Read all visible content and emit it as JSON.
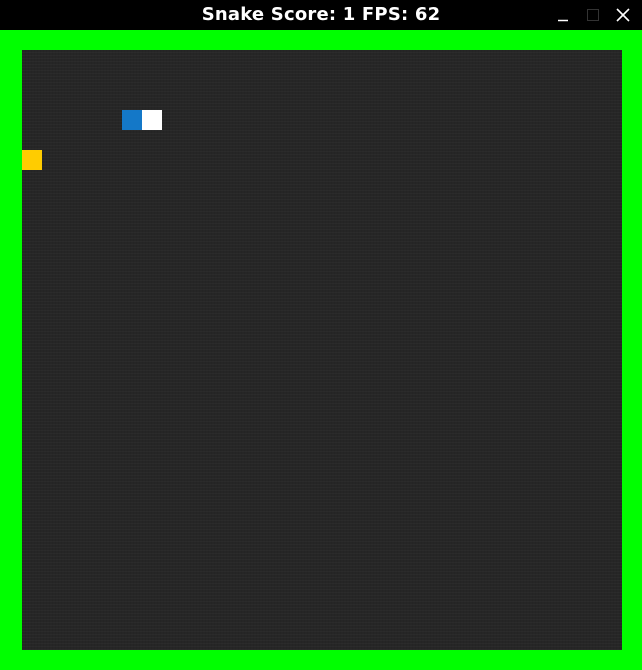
{
  "window": {
    "title": "Snake Score: 1 FPS: 62",
    "controls": {
      "minimize_icon": "minimize-icon",
      "maximize_icon": "maximize-icon",
      "close_icon": "close-icon"
    }
  },
  "game": {
    "score": 1,
    "fps": 62,
    "grid": {
      "columns": 30,
      "rows": 30
    },
    "snake": {
      "head": {
        "col": 6,
        "row": 3
      },
      "body": [
        {
          "col": 5,
          "row": 3
        }
      ]
    },
    "food": {
      "col": 0,
      "row": 5
    }
  },
  "colors": {
    "titlebar_bg": "#000000",
    "title_text": "#ffffff",
    "wall": "#00ff00",
    "board": "#262626",
    "snake_head": "#ffffff",
    "snake_body": "#1478c8",
    "food": "#ffcc00"
  }
}
